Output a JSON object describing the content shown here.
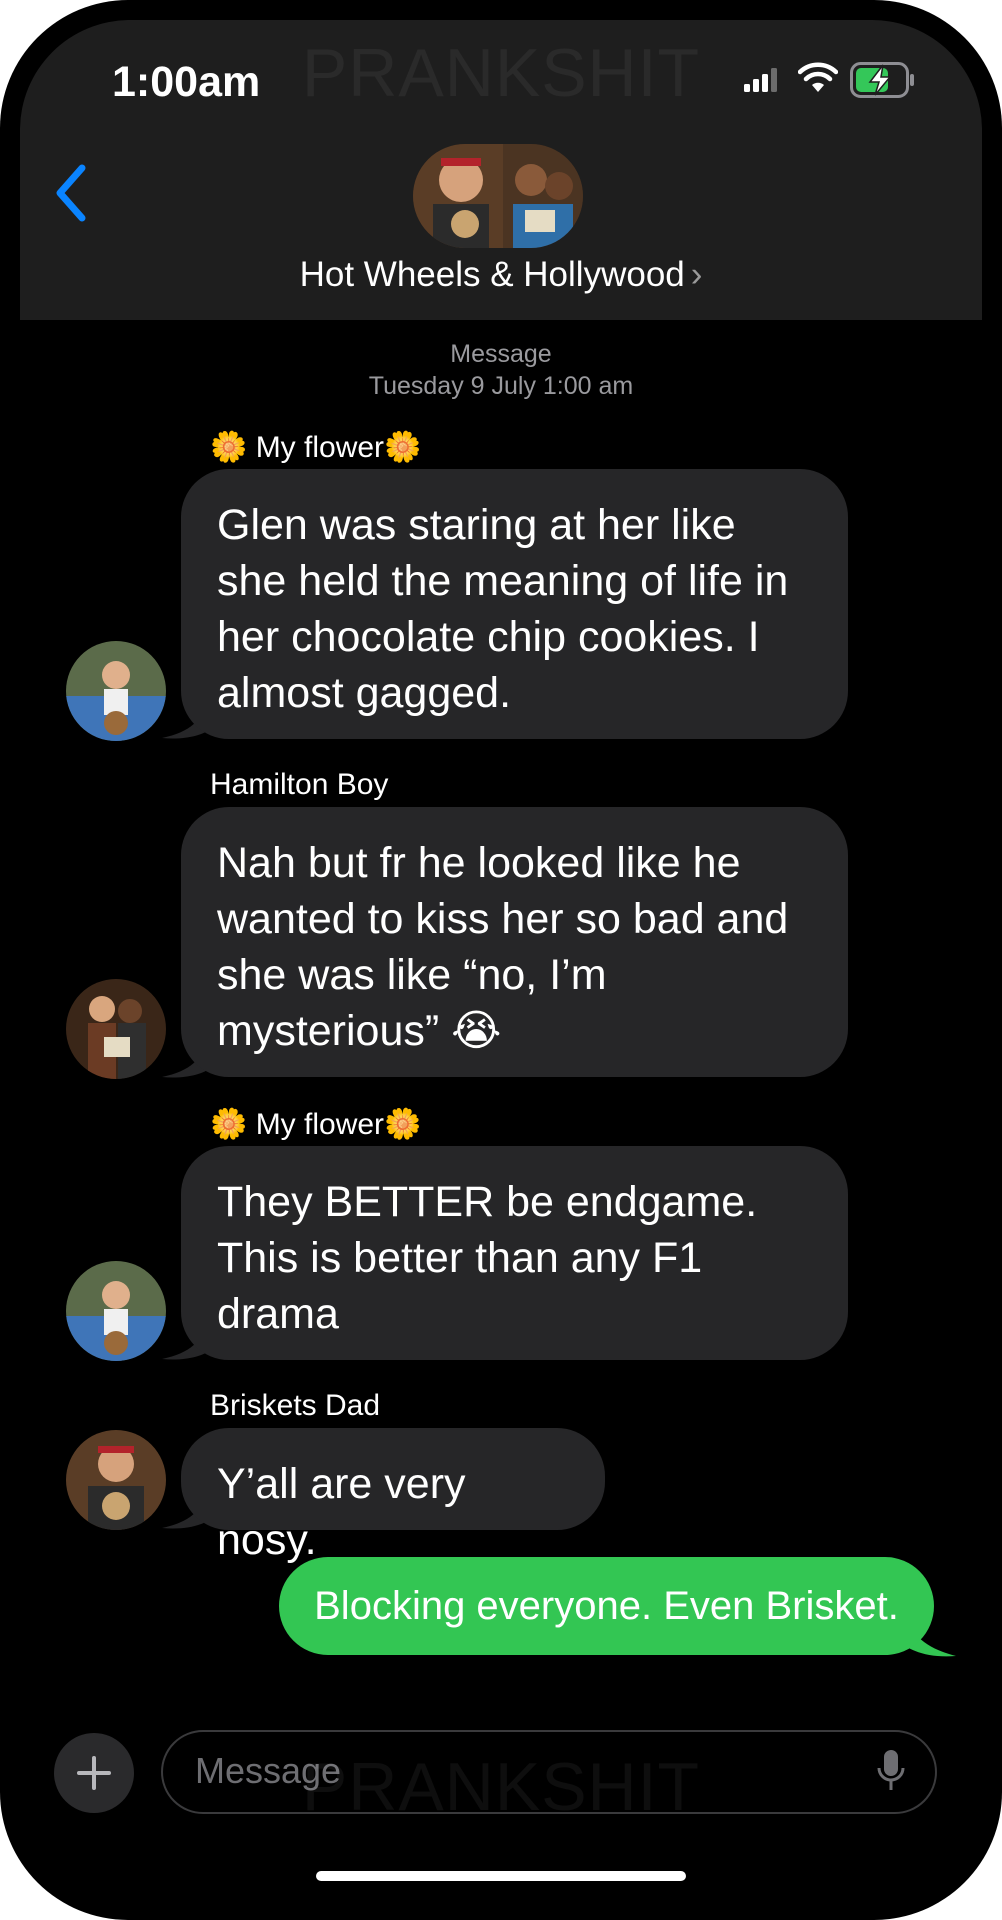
{
  "status": {
    "time": "1:00am",
    "watermark": "PRANKSHIT"
  },
  "header": {
    "group_name": "Hot Wheels & Hollywood",
    "chevron": "›"
  },
  "thread_meta": {
    "label": "Message",
    "timestamp": "Tuesday 9 July 1:00 am"
  },
  "messages": [
    {
      "sender": "🌼 My flower🌼",
      "text": "Glen was staring at her like she held the meaning of life in her chocolate chip cookies. I almost gagged."
    },
    {
      "sender": "Hamilton Boy",
      "text": "Nah but fr he looked like he wanted to kiss her so bad and she was like “no, I’m mysterious” 😭"
    },
    {
      "sender": "🌼 My flower🌼",
      "text": "They BETTER be endgame. This is better than any F1 drama"
    },
    {
      "sender": "Briskets Dad",
      "text": "Y’all are very nosy."
    }
  ],
  "outgoing": {
    "text": "Blocking everyone. Even Brisket."
  },
  "composer": {
    "placeholder": "Message"
  },
  "colors": {
    "accent": "#0a84ff",
    "outgoing_bubble": "#33c653",
    "incoming_bubble": "#262628",
    "header_bg": "#1e1e1e"
  }
}
